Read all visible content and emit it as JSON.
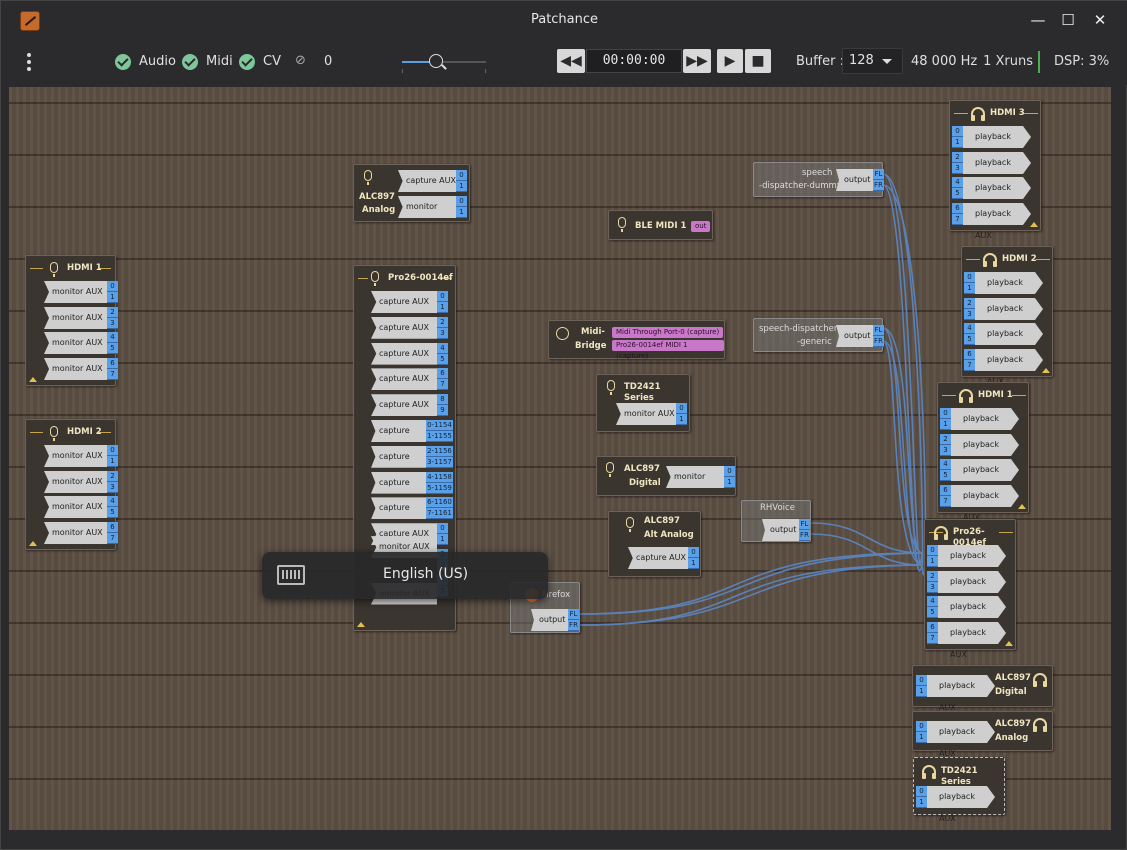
{
  "window": {
    "title": "Patchance"
  },
  "toolbar": {
    "audio_label": "Audio",
    "midi_label": "Midi",
    "cv_label": "CV",
    "hidden_count": "0",
    "time": "00:00:00",
    "buffer_label": "Buffer :",
    "buffer_value": "128",
    "samplerate": "48 000 Hz",
    "xruns": "1 Xruns",
    "dsp": "DSP: 3%",
    "rewind": "◀◀",
    "forward": "▶▶",
    "play": "▶",
    "stop": "■"
  },
  "osd": {
    "text": "English (US)"
  },
  "boxes": {
    "hdmi1_left": {
      "title": "HDMI 1",
      "port": "monitor AUX",
      "nums": [
        "0",
        "1",
        "2",
        "3",
        "4",
        "5",
        "6",
        "7"
      ]
    },
    "hdmi2_left": {
      "title": "HDMI 2",
      "port": "monitor AUX",
      "nums": [
        "0",
        "1",
        "2",
        "3",
        "4",
        "5",
        "6",
        "7"
      ]
    },
    "alc897_analog_cap": {
      "title": "ALC897\nAnalog",
      "t1": "ALC897",
      "t2": "Analog",
      "p1": "capture AUX",
      "p2": "monitor AUX"
    },
    "pro26": {
      "title": "Pro26-0014ef",
      "cap": "capture AUX",
      "mon": "monitor AUX",
      "nums": [
        "0",
        "1",
        "2",
        "3",
        "4",
        "5",
        "6",
        "7",
        "8",
        "9",
        "0-1154",
        "1-1155",
        "2-1156",
        "3-1157",
        "4-1158",
        "5-1159",
        "6-1160",
        "7-1161",
        "0",
        "1",
        "2",
        "3",
        "4",
        "5",
        "6",
        "7"
      ]
    },
    "ble": {
      "title": "BLE MIDI 1",
      "port": "out"
    },
    "midibridge": {
      "t1": "Midi-",
      "t2": "Bridge",
      "p1": "Midi Through Port-0 (capture)",
      "p2": "Pro26-0014ef MIDI 1 (capture)"
    },
    "td2421_cap": {
      "title": "TD2421 Series",
      "port": "monitor AUX"
    },
    "alc897_digital_cap": {
      "t1": "ALC897",
      "t2": "Digital",
      "port": "monitor AUX"
    },
    "alc897_alt": {
      "t1": "ALC897",
      "t2": "Alt Analog",
      "port": "capture AUX"
    },
    "firefox": {
      "title": "Firefox",
      "port": "output",
      "fl": "FL",
      "fr": "FR"
    },
    "rhvoice": {
      "title": "RHVoice",
      "port": "output",
      "fl": "FL",
      "fr": "FR"
    },
    "sdd": {
      "t1": "speech",
      "t2": "-dispatcher-dummy",
      "port": "output",
      "fl": "FL",
      "fr": "FR"
    },
    "sdg": {
      "t1": "speech-dispatcher",
      "t2": "-generic",
      "port": "output",
      "fl": "FL",
      "fr": "FR"
    },
    "hdmi3": {
      "title": "HDMI 3",
      "port": "playback AUX"
    },
    "hdmi2": {
      "title": "HDMI 2",
      "port": "playback AUX"
    },
    "hdmi1": {
      "title": "HDMI 1",
      "port": "playback AUX"
    },
    "pro26_pb": {
      "title": "Pro26-0014ef",
      "port": "playback AUX"
    },
    "alc897_digital_pb": {
      "t1": "ALC897",
      "t2": "Digital",
      "port": "playback AUX"
    },
    "alc897_analog_pb": {
      "t1": "ALC897",
      "t2": "Analog",
      "port": "playback AUX"
    },
    "td2421_pb": {
      "title": "TD2421 Series",
      "port": "playback AUX"
    }
  },
  "colors": {
    "accent": "#5aa0e8",
    "wire": "#5b87c5",
    "midi": "#c977c9",
    "dsp_ok": "#4caf50",
    "check": "#7fc79a"
  }
}
